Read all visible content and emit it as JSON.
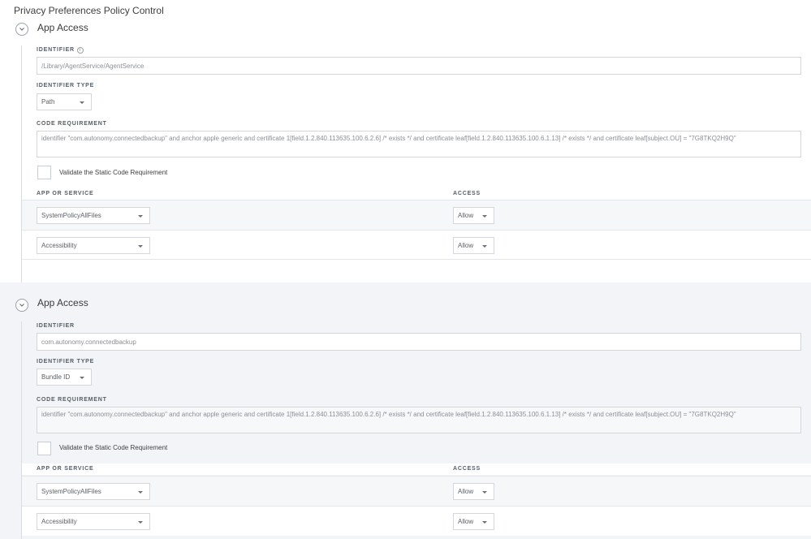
{
  "page": {
    "title": "Privacy Preferences Policy Control"
  },
  "sections": [
    {
      "title": "App Access",
      "identifier_label": "IDENTIFIER",
      "identifier_value": "/Library/AgentService/AgentService",
      "identifier_type_label": "IDENTIFIER TYPE",
      "identifier_type_value": "Path",
      "code_requirement_label": "CODE REQUIREMENT",
      "code_requirement_value": "identifier \"com.autonomy.connectedbackup\" and anchor apple generic and certificate 1[field.1.2.840.113635.100.6.2.6] /* exists */ and certificate leaf[field.1.2.840.113635.100.6.1.13] /* exists */ and certificate leaf[subject.OU] = \"7G8TKQ2H9Q\"",
      "validate_label": "Validate the Static Code Requirement",
      "validate_checked": false,
      "col_app": "APP OR SERVICE",
      "col_access": "ACCESS",
      "rows": [
        {
          "service": "SystemPolicyAllFiles",
          "access": "Allow"
        },
        {
          "service": "Accessibility",
          "access": "Allow"
        }
      ]
    },
    {
      "title": "App Access",
      "identifier_label": "IDENTIFIER",
      "identifier_value": "com.autonomy.connectedbackup",
      "identifier_type_label": "IDENTIFIER TYPE",
      "identifier_type_value": "Bundle ID",
      "code_requirement_label": "CODE REQUIREMENT",
      "code_requirement_value": "identifier \"com.autonomy.connectedbackup\" and anchor apple generic and certificate 1[field.1.2.840.113635.100.6.2.6] /* exists */ and certificate leaf[field.1.2.840.113635.100.6.1.13] /* exists */ and certificate leaf[subject.OU] = \"7G8TKQ2H9Q\"",
      "validate_label": "Validate the Static Code Requirement",
      "validate_checked": false,
      "col_app": "APP OR SERVICE",
      "col_access": "ACCESS",
      "rows": [
        {
          "service": "SystemPolicyAllFiles",
          "access": "Allow"
        },
        {
          "service": "Accessibility",
          "access": "Allow"
        }
      ]
    }
  ],
  "icons": {
    "collapse": "chevron-down-icon",
    "info": "info-icon",
    "dropdown": "caret-down-icon"
  }
}
